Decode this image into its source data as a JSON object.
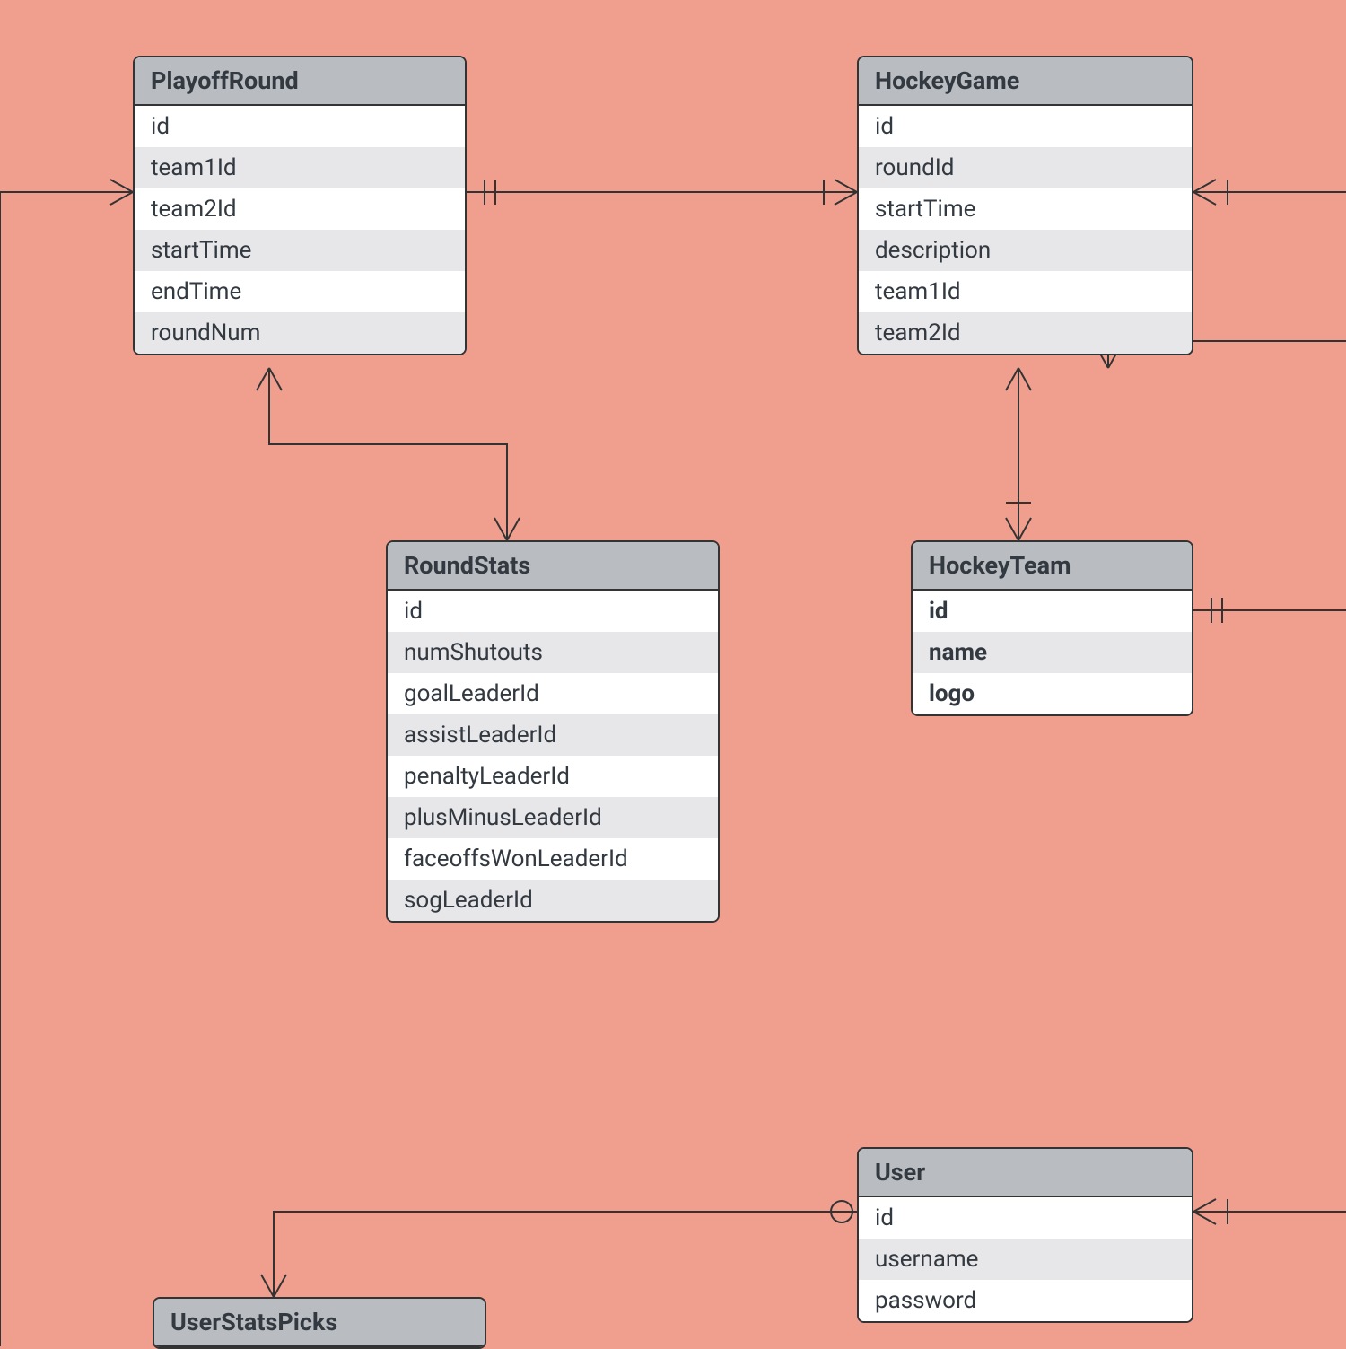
{
  "entities": {
    "playoffRound": {
      "title": "PlayoffRound",
      "rows": [
        "id",
        "team1Id",
        "team2Id",
        "startTime",
        "endTime",
        "roundNum"
      ]
    },
    "hockeyGame": {
      "title": "HockeyGame",
      "rows": [
        "id",
        "roundId",
        "startTime",
        "description",
        "team1Id",
        "team2Id"
      ]
    },
    "roundStats": {
      "title": "RoundStats",
      "rows": [
        "id",
        "numShutouts",
        "goalLeaderId",
        "assistLeaderId",
        "penaltyLeaderId",
        "plusMinusLeaderId",
        "faceoffsWonLeaderId",
        "sogLeaderId"
      ]
    },
    "hockeyTeam": {
      "title": "HockeyTeam",
      "rows": [
        "id",
        "name",
        "logo"
      ],
      "bold": true
    },
    "user": {
      "title": "User",
      "rows": [
        "id",
        "username",
        "password"
      ]
    },
    "userStatsPicks": {
      "title": "UserStatsPicks",
      "rows": []
    }
  }
}
